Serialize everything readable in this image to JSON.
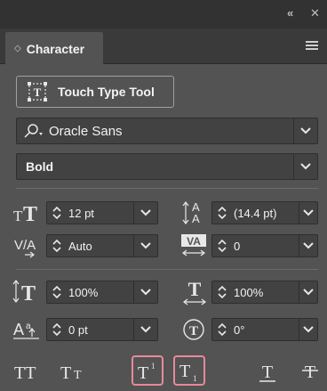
{
  "panel": {
    "title": "Character",
    "collapse_icon": "double-chevron-left",
    "close_icon": "x",
    "menu_icon": "hamburger"
  },
  "touch_type": {
    "label": "Touch Type Tool"
  },
  "font_family": {
    "value": "Oracle Sans"
  },
  "font_style": {
    "value": "Bold"
  },
  "fields": {
    "font_size": "12 pt",
    "leading": "(14.4 pt)",
    "kerning": "Auto",
    "tracking": "0",
    "vertical_scale": "100%",
    "horizontal_scale": "100%",
    "baseline_shift": "0 pt",
    "rotation": "0°"
  },
  "bottom_buttons": [
    "All Caps",
    "Small Caps",
    "Superscript",
    "Subscript",
    "Underline",
    "Strikethrough"
  ],
  "colors": {
    "panel_bg": "#535353",
    "field_bg": "#424242",
    "highlight": "#e68a9a"
  }
}
